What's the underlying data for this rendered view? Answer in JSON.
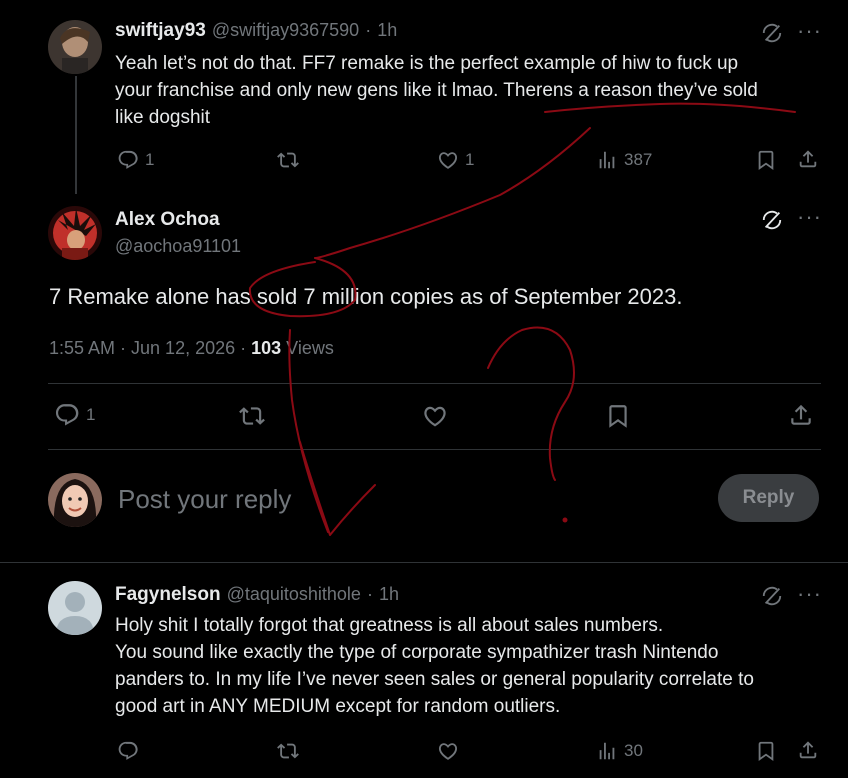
{
  "tweet1": {
    "name": "swiftjay93",
    "handle": "@swiftjay9367590",
    "sep": "·",
    "time": "1h",
    "text_a": "Yeah let’s not do that. FF7 remake is the perfect example of hiw to fuck up",
    "text_b": "your franchise and only new gens like it lmao. Therens a reason they’ve sold",
    "text_c": "like dogshit",
    "replies": "1",
    "likes": "1",
    "views": "387"
  },
  "main": {
    "name": "Alex Ochoa",
    "handle": "@aochoa91101",
    "text": "7 Remake alone has sold 7 million copies as of September 2023.",
    "time": "1:55 AM · Jun 12, 2026 · ",
    "views_count": "103",
    "views_label": " Views",
    "replies": "1"
  },
  "composer": {
    "placeholder": "Post your reply",
    "button": "Reply"
  },
  "tweet3": {
    "name": "Fagynelson",
    "handle": "@taquitoshithole",
    "sep": "·",
    "time": "1h",
    "line1": "Holy shit I totally forgot that greatness is all about sales numbers.",
    "line2": "You sound like exactly the type of corporate sympathizer trash Nintendo",
    "line3": "panders to. In my life I’ve never seen sales or general popularity correlate to",
    "line4": "good art in ANY MEDIUM except for random outliers.",
    "views": "30"
  },
  "colors": {
    "background": "#000000",
    "text": "#e7e9ea",
    "muted": "#71767b",
    "annotation": "#8b0a14"
  },
  "icons": [
    "grok-icon",
    "more-icon",
    "reply-icon",
    "retweet-icon",
    "like-icon",
    "views-icon",
    "bookmark-icon",
    "share-icon"
  ]
}
